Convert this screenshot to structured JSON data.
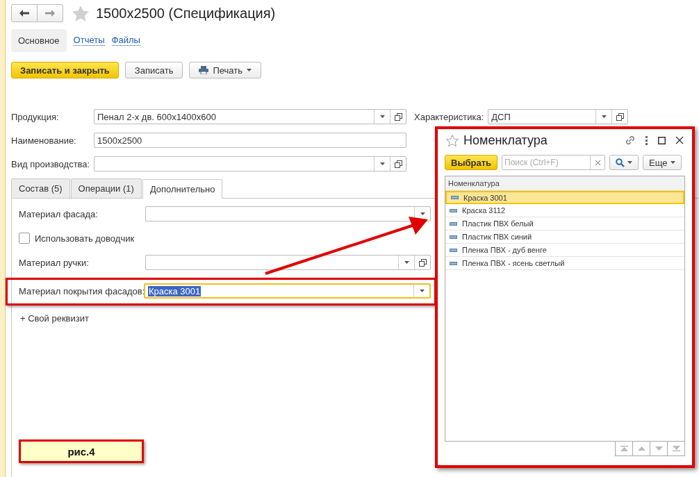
{
  "header": {
    "title": "1500x2500 (Спецификация)"
  },
  "sections": [
    {
      "label": "Основное",
      "selected": true
    },
    {
      "label": "Отчеты",
      "selected": false
    },
    {
      "label": "Файлы",
      "selected": false
    }
  ],
  "commands": [
    {
      "label": "Записать и закрыть",
      "kind": "primary"
    },
    {
      "label": "Записать",
      "kind": "plain"
    },
    {
      "label": "Печать",
      "kind": "print"
    }
  ],
  "fields": [
    {
      "label": "Продукция:",
      "value": "Пенал 2-х дв. 600x1400x600",
      "kind": "choice"
    },
    {
      "label": "Наименование:",
      "value": "1500x2500",
      "kind": "text"
    },
    {
      "label": "Вид производства:",
      "kind": "choice"
    }
  ],
  "characteristic": {
    "label": "Характеристика:",
    "value": "ДСП"
  },
  "tabs": [
    {
      "label": "Состав (5)",
      "selected": false
    },
    {
      "label": "Операции (1)",
      "selected": false
    },
    {
      "label": "Дополнительно",
      "selected": true
    }
  ],
  "extra_fields": [
    {
      "label": "Материал фасада:",
      "kind": "dropdown"
    },
    {
      "label": "Использовать доводчик",
      "kind": "checkbox",
      "checked": false
    },
    {
      "label": "Материал ручки:",
      "kind": "choice"
    },
    {
      "label": "Материал покрытия фасадов:",
      "kind": "focused",
      "value": "Краска 3001"
    }
  ],
  "add_link": "+ Свой реквизит",
  "caption": "рис.4",
  "popup": {
    "title": "Номенклатура",
    "select_button": "Выбрать",
    "search": {
      "placeholder": "Поиск (Ctrl+F)"
    },
    "more_button": "Еще",
    "column": "Номенклатура",
    "rows": [
      {
        "name": "Краска 3001",
        "selected": true
      },
      {
        "name": "Краска 3112",
        "selected": false
      },
      {
        "name": "Пластик ПВХ белый",
        "selected": false
      },
      {
        "name": "Пластик ПВХ синий",
        "selected": false
      },
      {
        "name": "Пленка ПВХ - дуб венге",
        "selected": false
      },
      {
        "name": "Пленка ПВХ - ясень светлый",
        "selected": false
      }
    ]
  }
}
